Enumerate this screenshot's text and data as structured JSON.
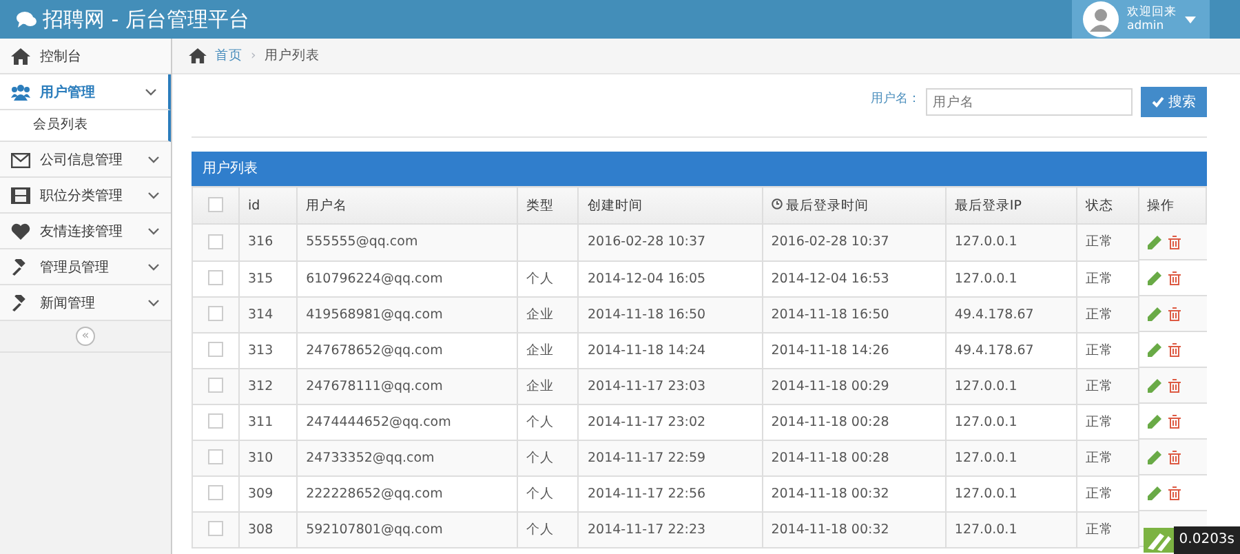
{
  "header": {
    "title": "招聘网 - 后台管理平台",
    "welcome": "欢迎回来",
    "user": "admin"
  },
  "sidebar": {
    "items": [
      {
        "label": "控制台",
        "kind": "home",
        "selected": false,
        "expandable": false
      },
      {
        "label": "用户管理",
        "kind": "users",
        "selected": true,
        "expandable": true,
        "children": [
          {
            "label": "会员列表",
            "selected": false
          }
        ]
      },
      {
        "label": "公司信息管理",
        "kind": "envelope",
        "selected": false,
        "expandable": true
      },
      {
        "label": "职位分类管理",
        "kind": "film",
        "selected": false,
        "expandable": true
      },
      {
        "label": "友情连接管理",
        "kind": "heart",
        "selected": false,
        "expandable": true
      },
      {
        "label": "管理员管理",
        "kind": "gavel",
        "selected": false,
        "expandable": true
      },
      {
        "label": "新闻管理",
        "kind": "gavel",
        "selected": false,
        "expandable": true
      }
    ],
    "collapse": "«"
  },
  "breadcrumb": {
    "separator": "›",
    "items": [
      "首页",
      "用户列表"
    ]
  },
  "search": {
    "label": "用户名：",
    "placeholder": "用户名",
    "button": "搜索"
  },
  "table": {
    "title": "用户列表",
    "header_checked": false,
    "columns": [
      "id",
      "用户名",
      "类型",
      "创建时间",
      "最后登录时间",
      "最后登录IP",
      "状态",
      "操作"
    ],
    "rows": [
      {
        "checked": false,
        "cells": [
          "316",
          "555555@qq.com",
          "",
          "2016-02-28 10:37",
          "2016-02-28 10:37",
          "127.0.0.1",
          "正常"
        ]
      },
      {
        "checked": false,
        "cells": [
          "315",
          "610796224@qq.com",
          "个人",
          "2014-12-04 16:05",
          "2014-12-04 16:53",
          "127.0.0.1",
          "正常"
        ]
      },
      {
        "checked": false,
        "cells": [
          "314",
          "419568981@qq.com",
          "企业",
          "2014-11-18 16:50",
          "2014-11-18 16:50",
          "49.4.178.67",
          "正常"
        ]
      },
      {
        "checked": false,
        "cells": [
          "313",
          "247678652@qq.com",
          "企业",
          "2014-11-18 14:24",
          "2014-11-18 14:26",
          "49.4.178.67",
          "正常"
        ]
      },
      {
        "checked": false,
        "cells": [
          "312",
          "247678111@qq.com",
          "企业",
          "2014-11-17 23:03",
          "2014-11-18 00:29",
          "127.0.0.1",
          "正常"
        ]
      },
      {
        "checked": false,
        "cells": [
          "311",
          "2474444652@qq.com",
          "个人",
          "2014-11-17 23:02",
          "2014-11-18 00:28",
          "127.0.0.1",
          "正常"
        ]
      },
      {
        "checked": false,
        "cells": [
          "310",
          "24733352@qq.com",
          "个人",
          "2014-11-17 22:59",
          "2014-11-18 00:28",
          "127.0.0.1",
          "正常"
        ]
      },
      {
        "checked": false,
        "cells": [
          "309",
          "222228652@qq.com",
          "个人",
          "2014-11-17 22:56",
          "2014-11-18 00:32",
          "127.0.0.1",
          "正常"
        ]
      },
      {
        "checked": false,
        "cells": [
          "308",
          "592107801@qq.com",
          "个人",
          "2014-11-17 22:23",
          "2014-11-18 00:32",
          "127.0.0.1",
          "正常"
        ]
      }
    ]
  },
  "debug_timer": "0.0203s"
}
